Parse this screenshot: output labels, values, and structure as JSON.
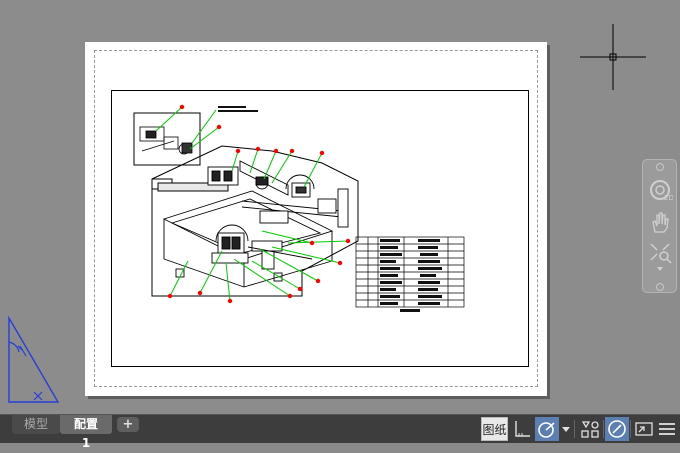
{
  "tabs": {
    "model_label": "模型",
    "layout1_label": "配置1",
    "add_label": "+"
  },
  "status": {
    "paper_space_label": "图纸"
  },
  "colors": {
    "canvas": "#8c8c8c",
    "paper": "#ffffff",
    "leader_lines": "#00cc00",
    "balloons": "#ff0000",
    "ucs_icon": "#2440d8",
    "active_toggle": "#5b7fb0"
  },
  "icons": {
    "crosshair": "crosshair-cursor-icon",
    "ucs": "ucs-triangle-icon",
    "steering_wheel": "steering-wheel-icon",
    "pan": "pan-hand-icon",
    "zoom": "zoom-icon",
    "grid": "grid-icon",
    "snap": "snap-icon",
    "polar": "polar-tracking-icon",
    "object_snap": "object-snap-icon",
    "annotation": "annotation-icon",
    "fullscreen": "fullscreen-icon",
    "menu": "menu-icon"
  }
}
